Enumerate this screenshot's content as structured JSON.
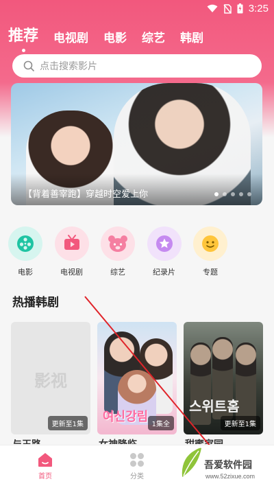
{
  "status_bar": {
    "time": "3:25"
  },
  "tabs": [
    {
      "label": "推荐",
      "active": true
    },
    {
      "label": "电视剧"
    },
    {
      "label": "电影"
    },
    {
      "label": "综艺"
    },
    {
      "label": "韩剧"
    }
  ],
  "search": {
    "placeholder": "点击搜索影片"
  },
  "banner": {
    "caption": "【背着善宰跑】穿越时空爱上你",
    "dot_count": 5,
    "active_dot": 0
  },
  "categories": [
    {
      "label": "电影",
      "icon": "film-reel-icon",
      "bg": "#d6f5ef",
      "fg": "#1fc4a3"
    },
    {
      "label": "电视剧",
      "icon": "tv-icon",
      "bg": "#fde0e7",
      "fg": "#f2587d"
    },
    {
      "label": "综艺",
      "icon": "bear-face-icon",
      "bg": "#fde0e7",
      "fg": "#f57fa1"
    },
    {
      "label": "纪录片",
      "icon": "star-badge-icon",
      "bg": "#f1e2fb",
      "fg": "#c58af0"
    },
    {
      "label": "专题",
      "icon": "smiley-icon",
      "bg": "#fff0cf",
      "fg": "#ffc53a"
    }
  ],
  "section": {
    "title": "热播韩剧"
  },
  "cards": [
    {
      "placeholder_text": "影视",
      "badge": "更新至1集",
      "title_peek": "与王路"
    },
    {
      "poster_title": "여신강림",
      "badge": "1集全",
      "title_peek": "女神降临"
    },
    {
      "poster_title": "스위트홈",
      "badge": "更新至1集",
      "title_peek": "甜蜜家园"
    }
  ],
  "bottom_nav": [
    {
      "label": "首页",
      "icon": "home-icon",
      "active": true
    },
    {
      "label": "分类",
      "icon": "category-grid-icon",
      "active": false
    }
  ],
  "colors": {
    "accent": "#f2587d",
    "inactive": "#9a9a9a"
  },
  "watermark": {
    "name": "吾爱软件园",
    "url": "www.52zixue.com"
  }
}
